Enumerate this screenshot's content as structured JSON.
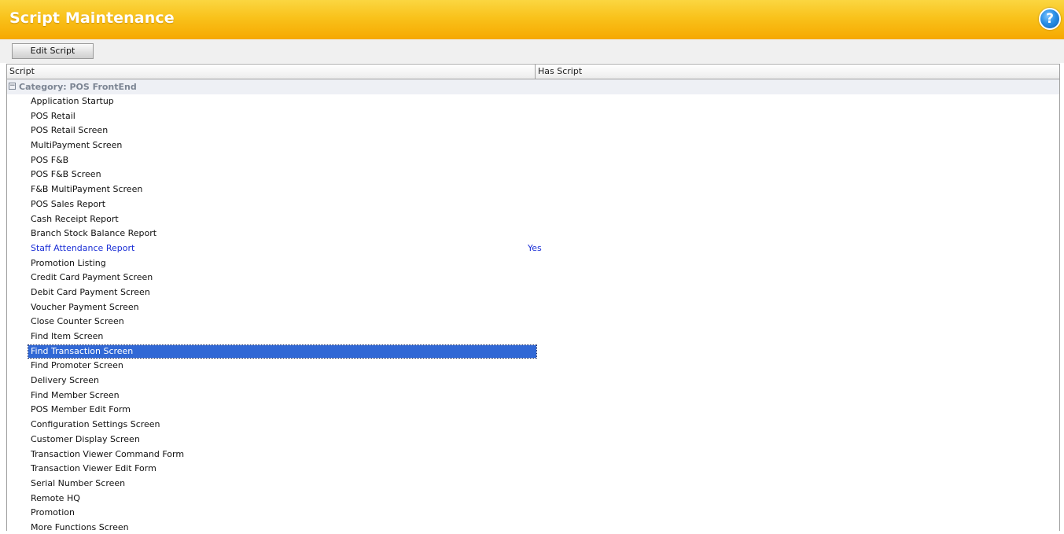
{
  "window": {
    "title": "Script Maintenance",
    "help_glyph": "?"
  },
  "toolbar": {
    "edit_label": "Edit Script"
  },
  "grid": {
    "columns": [
      "Script",
      "Has Script"
    ],
    "group_label": "Category: POS FrontEnd",
    "group_expander": "−",
    "selected_index": 17,
    "rows": [
      {
        "name": "Application Startup",
        "has_script": ""
      },
      {
        "name": "POS Retail",
        "has_script": ""
      },
      {
        "name": "POS Retail Screen",
        "has_script": ""
      },
      {
        "name": "MultiPayment Screen",
        "has_script": ""
      },
      {
        "name": "POS F&B",
        "has_script": ""
      },
      {
        "name": "POS F&B Screen",
        "has_script": ""
      },
      {
        "name": "F&B MultiPayment Screen",
        "has_script": ""
      },
      {
        "name": "POS Sales Report",
        "has_script": ""
      },
      {
        "name": "Cash Receipt Report",
        "has_script": ""
      },
      {
        "name": "Branch Stock Balance Report",
        "has_script": ""
      },
      {
        "name": "Staff Attendance Report",
        "has_script": "Yes"
      },
      {
        "name": "Promotion Listing",
        "has_script": ""
      },
      {
        "name": "Credit Card Payment Screen",
        "has_script": ""
      },
      {
        "name": "Debit Card Payment Screen",
        "has_script": ""
      },
      {
        "name": "Voucher Payment Screen",
        "has_script": ""
      },
      {
        "name": "Close Counter Screen",
        "has_script": ""
      },
      {
        "name": "Find Item Screen",
        "has_script": ""
      },
      {
        "name": "Find Transaction Screen",
        "has_script": ""
      },
      {
        "name": "Find Promoter Screen",
        "has_script": ""
      },
      {
        "name": "Delivery Screen",
        "has_script": ""
      },
      {
        "name": "Find Member Screen",
        "has_script": ""
      },
      {
        "name": "POS Member Edit Form",
        "has_script": ""
      },
      {
        "name": "Configuration Settings Screen",
        "has_script": ""
      },
      {
        "name": "Customer Display Screen",
        "has_script": ""
      },
      {
        "name": "Transaction Viewer Command Form",
        "has_script": ""
      },
      {
        "name": "Transaction Viewer Edit Form",
        "has_script": ""
      },
      {
        "name": "Serial Number Screen",
        "has_script": ""
      },
      {
        "name": "Remote HQ",
        "has_script": ""
      },
      {
        "name": "Promotion",
        "has_script": ""
      },
      {
        "name": "More Functions Screen",
        "has_script": ""
      }
    ]
  },
  "colors": {
    "title_bar": "#f9c21b",
    "has_script_text": "#1b2fd6",
    "selection": "#3168d5",
    "group_row_bg": "#eef0f5"
  },
  "icons": {
    "help": "help-icon",
    "group_expander": "collapse-icon"
  }
}
